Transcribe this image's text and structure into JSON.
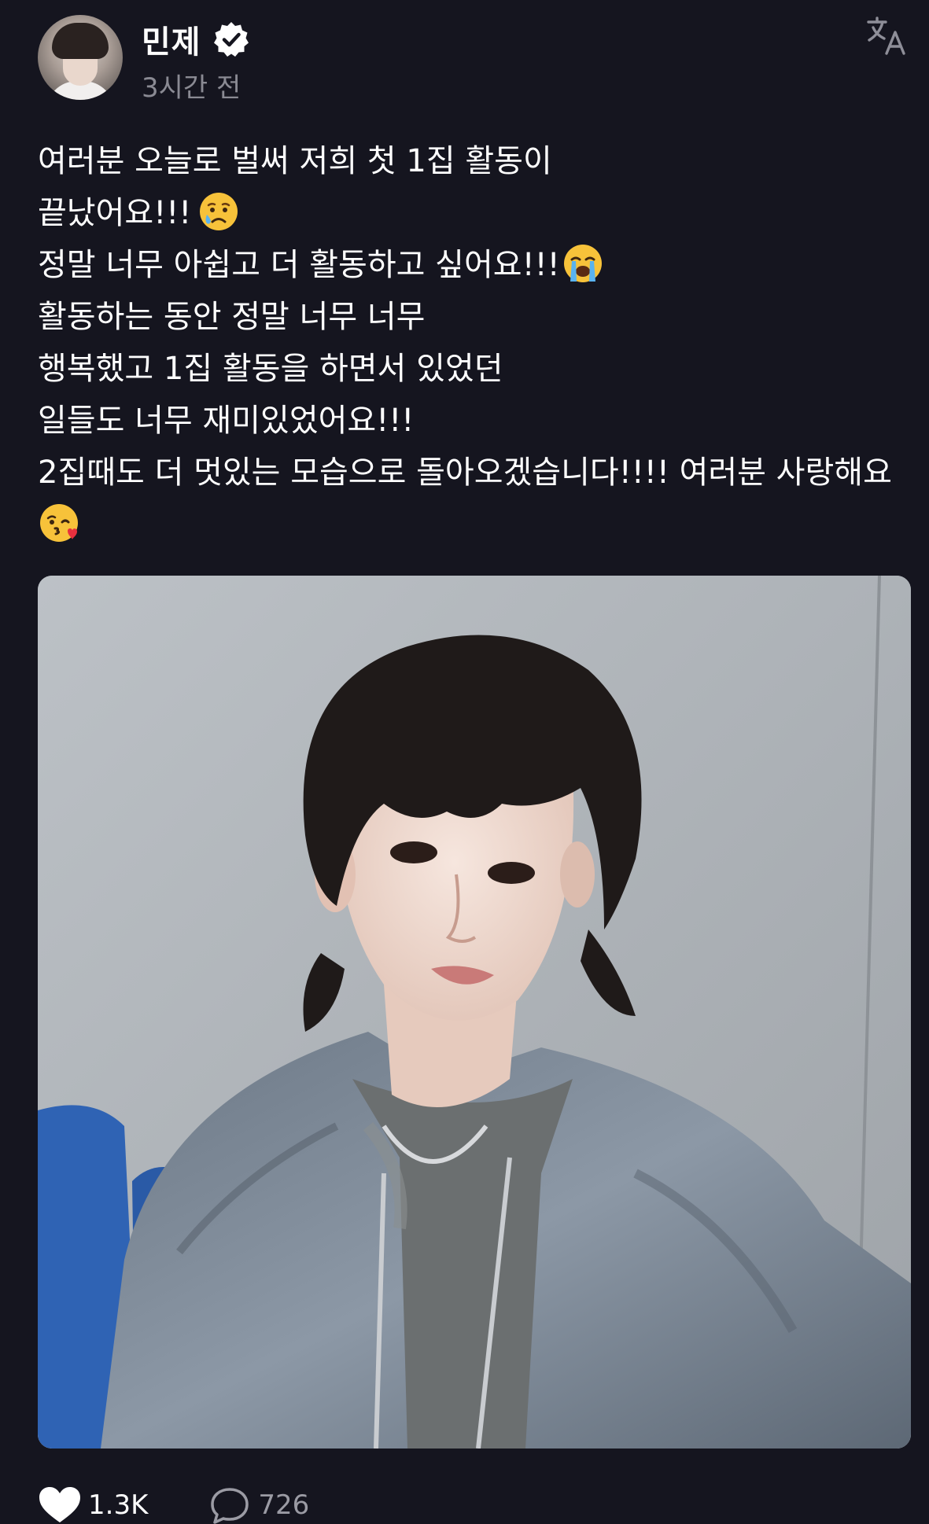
{
  "author": {
    "username": "민제",
    "verified": true,
    "timestamp": "3시간 전"
  },
  "header": {
    "translate_icon": "translate-icon"
  },
  "post": {
    "lines": [
      "여러분 오늘로 벌써 저희 첫 1집 활동이",
      "끝났어요!!!",
      "정말 너무 아쉽고 더 활동하고 싶어요!!!",
      "활동하는 동안 정말 너무 너무",
      "행복했고 1집 활동을 하면서 있었던",
      "일들도 너무 재미있었어요!!!",
      "2집때도 더 멋있는 모습으로 돌아오겠습니다!!!! 여러분 사랑해요"
    ],
    "emojis": [
      "crying-face-emoji",
      "loudly-crying-face-emoji",
      "face-blowing-kiss-emoji"
    ]
  },
  "stats": {
    "likes": "1.3K",
    "replies": "726"
  },
  "colors": {
    "background": "#15151f",
    "text": "#ffffff",
    "muted": "#8a8a93"
  }
}
